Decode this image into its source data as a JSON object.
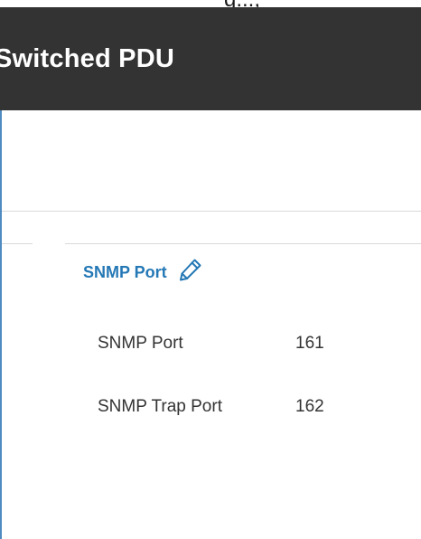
{
  "header": {
    "top_fragment": "g...,",
    "title": "Switched PDU"
  },
  "colors": {
    "header_bg": "#333333",
    "accent": "#2478b5",
    "left_border": "#4f8bc0",
    "divider": "#d9d9d9"
  },
  "snmp": {
    "section_title": "SNMP Port",
    "edit_icon": "pencil-icon",
    "rows": [
      {
        "label": "SNMP Port",
        "value": "161"
      },
      {
        "label": "SNMP Trap Port",
        "value": "162"
      }
    ]
  }
}
